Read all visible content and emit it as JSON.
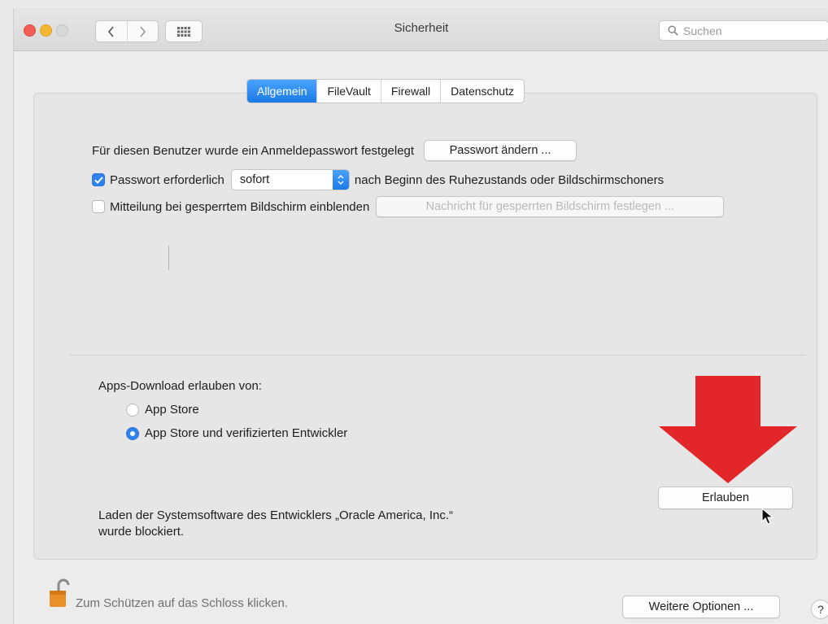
{
  "window": {
    "title": "Sicherheit"
  },
  "toolbar": {
    "search_placeholder": "Suchen"
  },
  "tabs": [
    {
      "label": "Allgemein",
      "active": true
    },
    {
      "label": "FileVault",
      "active": false
    },
    {
      "label": "Firewall",
      "active": false
    },
    {
      "label": "Datenschutz",
      "active": false
    }
  ],
  "general": {
    "password_text": "Für diesen Benutzer wurde ein Anmeldepasswort festgelegt",
    "change_password_button": "Passwort ändern ...",
    "require_password": {
      "label": "Passwort erforderlich",
      "checked": true
    },
    "require_select_value": "sofort",
    "require_suffix": "nach Beginn des Ruhezustands oder Bildschirmschoners",
    "lock_message": {
      "label": "Mitteilung bei gesperrtem Bildschirm einblenden",
      "checked": false
    },
    "set_message_button": "Nachricht für gesperrten Bildschirm festlegen ..."
  },
  "downloads": {
    "label": "Apps-Download erlauben von:",
    "options": [
      {
        "label": "App Store",
        "selected": false
      },
      {
        "label": "App Store und verifizierten Entwickler",
        "selected": true
      }
    ]
  },
  "blocked": {
    "line1": "Laden der Systemsoftware des Entwicklers „Oracle America, Inc.“",
    "line2": "wurde blockiert.",
    "allow_button": "Erlauben"
  },
  "footer": {
    "lock_text": "Zum Schützen auf das Schloss klicken.",
    "advanced_button": "Weitere Optionen ...",
    "help_label": "?"
  },
  "colors": {
    "accent": "#2f82f0",
    "annotation_arrow": "#e3262a"
  }
}
